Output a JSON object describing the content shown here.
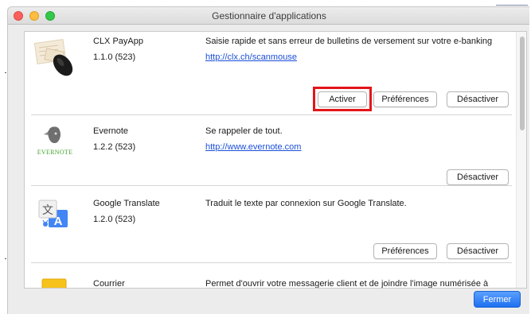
{
  "window": {
    "title": "Gestionnaire d'applications"
  },
  "apps": [
    {
      "name": "CLX PayApp",
      "version": "1.1.0 (523)",
      "description": "Saisie rapide et sans erreur de bulletins de versement sur votre e-banking",
      "link": "http://clx.ch/scanmouse",
      "icon": "scanmouse-icon",
      "buttons": {
        "activate": "Activer",
        "preferences": "Préférences",
        "deactivate": "Désactiver"
      }
    },
    {
      "name": "Evernote",
      "version": "1.2.2 (523)",
      "description": "Se rappeler de tout.",
      "link": "http://www.evernote.com",
      "icon": "evernote-icon",
      "icon_text": "EVERNOTE",
      "buttons": {
        "deactivate": "Désactiver"
      }
    },
    {
      "name": "Google Translate",
      "version": "1.2.0 (523)",
      "description": "Traduit le texte par connexion sur Google Translate.",
      "icon": "google-translate-icon",
      "icon_glyph_zh": "文",
      "icon_glyph_a": "A",
      "buttons": {
        "preferences": "Préférences",
        "deactivate": "Désactiver"
      }
    },
    {
      "name": "Courrier",
      "description": "Permet d'ouvrir votre messagerie client et de joindre l'image numérisée à",
      "icon": "mail-icon"
    }
  ],
  "footer": {
    "close_label": "Fermer"
  },
  "colors": {
    "accent": "#1f6ff0",
    "highlight": "#e3151a",
    "link": "#1b4fd8"
  }
}
